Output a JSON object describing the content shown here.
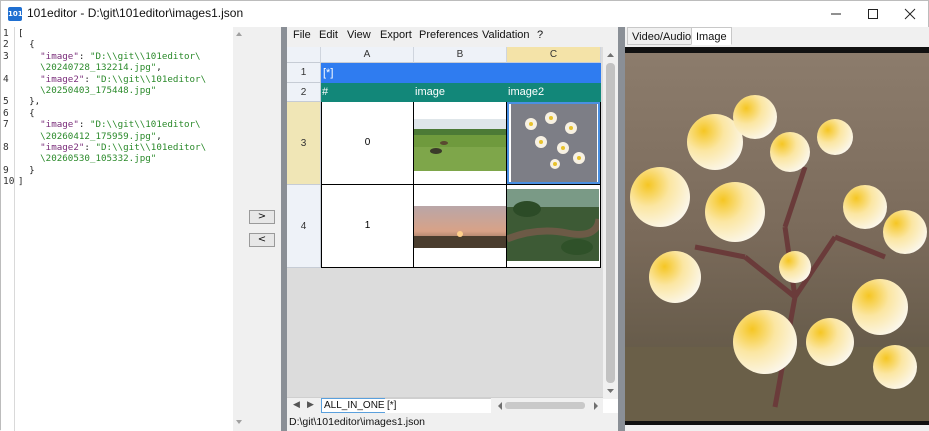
{
  "window": {
    "app_icon": "101",
    "title": "101editor - D:\\git\\101editor\\images1.json"
  },
  "editor": {
    "line_numbers": [
      "1",
      "2",
      "3",
      "",
      "4",
      "",
      "5",
      "6",
      "7",
      "",
      "8",
      "",
      "9",
      "10"
    ],
    "lines": [
      {
        "punc": "["
      },
      {
        "punc": "  {"
      },
      {
        "key": "    \"image\"",
        "sep": ": ",
        "str": "\"D:\\\\git\\\\101editor\\"
      },
      {
        "str": "    \\20240728_132214.jpg\"",
        "punc": ","
      },
      {
        "key": "    \"image2\"",
        "sep": ": ",
        "str": "\"D:\\\\git\\\\101editor\\"
      },
      {
        "str": "    \\20250403_175448.jpg\""
      },
      {
        "punc": "  },"
      },
      {
        "punc": "  {"
      },
      {
        "key": "    \"image\"",
        "sep": ": ",
        "str": "\"D:\\\\git\\\\101editor\\"
      },
      {
        "str": "    \\20260412_175959.jpg\"",
        "punc": ","
      },
      {
        "key": "    \"image2\"",
        "sep": ": ",
        "str": "\"D:\\\\git\\\\101editor\\"
      },
      {
        "str": "    \\20260530_105332.jpg\""
      },
      {
        "punc": "  }"
      },
      {
        "punc": "]"
      }
    ]
  },
  "mid_buttons": {
    "right_label": ">",
    "left_label": "<"
  },
  "menu": {
    "file": "File",
    "edit": "Edit",
    "view": "View",
    "export": "Export",
    "preferences": "Preferences",
    "validation": "Validation",
    "help": "?"
  },
  "grid": {
    "columns": [
      "A",
      "B",
      "C"
    ],
    "rows": [
      "1",
      "2",
      "3",
      "4"
    ],
    "title_cell": "[*]",
    "headers": [
      "#",
      "image",
      "image2"
    ],
    "data": [
      {
        "index": "0"
      },
      {
        "index": "1"
      }
    ]
  },
  "tabs": {
    "nav_prev": "◀",
    "nav_next": "▶",
    "sheet1": "ALL_IN_ONE",
    "sheet2": "[*]"
  },
  "status": {
    "path": "D:\\git\\101editor\\images1.json"
  },
  "preview": {
    "tab_video": "Video/Audio",
    "tab_image": "Image"
  },
  "colors": {
    "title_row": "#2f7cf0",
    "header_row": "#128779",
    "splitter": "#8a8f96"
  }
}
